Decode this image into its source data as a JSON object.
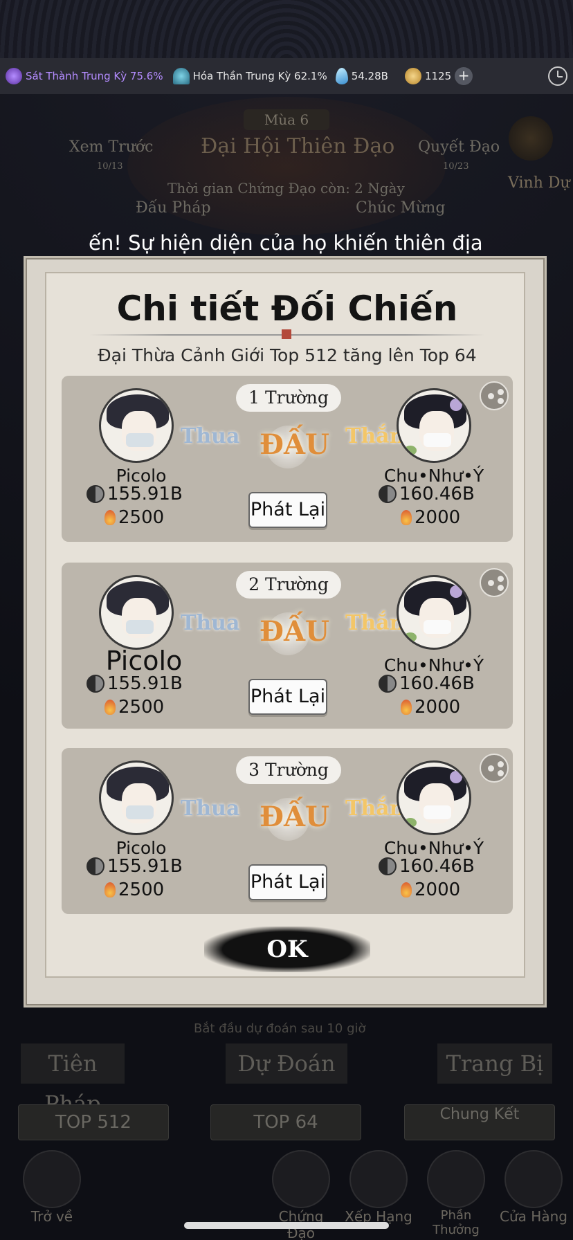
{
  "topbar": {
    "realm1": "Sát Thành Trung Kỳ 75.6%",
    "realm2": "Hóa Thần Trung Kỳ 62.1%",
    "spirit_stones": "54.28B",
    "coins": "1125",
    "plus": "+"
  },
  "backdrop": {
    "season": "Mùa 6",
    "event_title": "Đại Hội Thiên Đạo",
    "preview": "Xem Trước",
    "preview_date": "10/13",
    "decide": "Quyết Đạo",
    "decide_date": "10/23",
    "time_left": "Thời gian Chứng Đạo còn: 2 Ngày",
    "honor": "Vinh Dự",
    "dauphap": "Đấu Pháp",
    "congrats": "Chúc Mừng",
    "marquee": "ến! Sự hiện diện của họ khiến thiên địa",
    "predict_hint": "Bắt đầu dự đoán sau 10 giờ",
    "tab_left": "Tiên Pháp",
    "tab_mid": "Dự Đoán",
    "tab_right": "Trang Bị",
    "pill1": "TOP 512",
    "pill2": "TOP 64",
    "pill3": "Chung Kết",
    "nav": [
      "Trở về",
      "Chứng Đạo",
      "Xếp Hạng",
      "Phần Thưởng",
      "Cửa Hàng"
    ]
  },
  "modal": {
    "title": "Chi tiết Đối Chiến",
    "subtitle": "Đại Thừa Cảnh Giới Top 512 tăng lên Top 64",
    "vs_label": "ĐẤU",
    "replay_label": "Phát Lại",
    "ok_label": "OK",
    "matches": [
      {
        "round": "1 Trường",
        "left": {
          "name": "Picolo",
          "power": "155.91B",
          "score": "2500",
          "result": "Thua"
        },
        "right": {
          "name": "Chu•Như•Ý",
          "power": "160.46B",
          "score": "2000",
          "result": "Thắng"
        }
      },
      {
        "round": "2 Trường",
        "left": {
          "name": "Picolo",
          "power": "155.91B",
          "score": "2500",
          "result": "Thua"
        },
        "right": {
          "name": "Chu•Như•Ý",
          "power": "160.46B",
          "score": "2000",
          "result": "Thắng"
        }
      },
      {
        "round": "3 Trường",
        "left": {
          "name": "Picolo",
          "power": "155.91B",
          "score": "2500",
          "result": "Thua"
        },
        "right": {
          "name": "Chu•Như•Ý",
          "power": "160.46B",
          "score": "2000",
          "result": "Thắng"
        }
      }
    ]
  }
}
